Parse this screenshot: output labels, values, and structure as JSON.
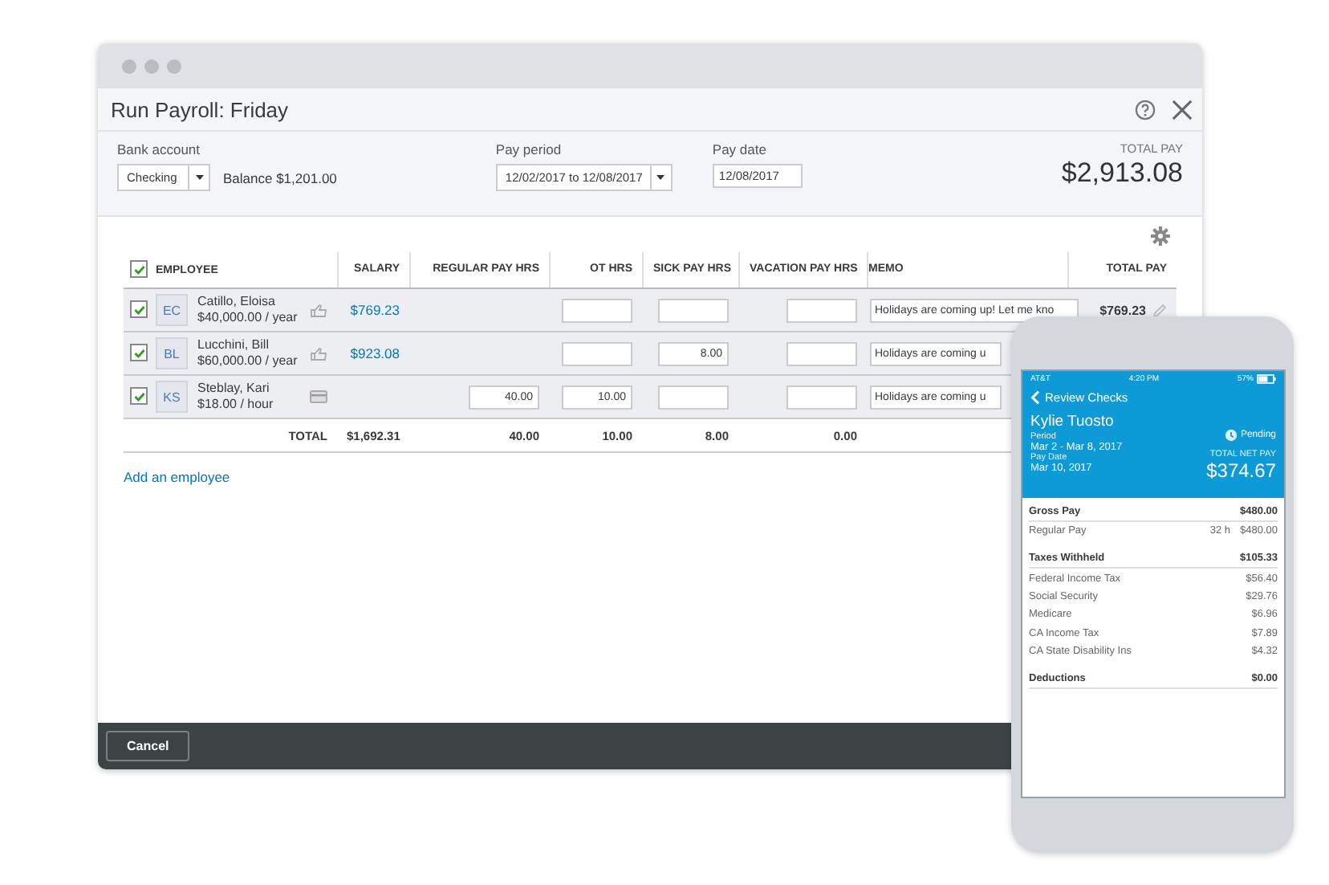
{
  "window": {
    "title": "Run Payroll: Friday"
  },
  "bank_account": {
    "label": "Bank account",
    "value": "Checking",
    "balance": "Balance $1,201.00"
  },
  "pay_period": {
    "label": "Pay period",
    "value": "12/02/2017 to 12/08/2017"
  },
  "pay_date": {
    "label": "Pay date",
    "value": "12/08/2017"
  },
  "total_pay": {
    "label": "TOTAL PAY",
    "amount": "$2,913.08"
  },
  "table": {
    "all_checked": true,
    "columns": [
      "EMPLOYEE",
      "SALARY",
      "REGULAR PAY HRS",
      "OT HRS",
      "SICK PAY HRS",
      "VACATION PAY HRS",
      "MEMO",
      "TOTAL PAY"
    ],
    "rows": [
      {
        "kind": "salaried",
        "checked": true,
        "initials": "EC",
        "name": "Catillo, Eloisa",
        "rate": "$40,000.00 / year",
        "salary": "$769.23",
        "memo": "Holidays are coming up! Let me kno",
        "total_pay": "$769.23"
      },
      {
        "kind": "salaried",
        "checked": true,
        "initials": "BL",
        "name": "Lucchini, Bill",
        "rate": "$60,000.00 / year",
        "salary": "$923.08",
        "sick_hrs": "8.00",
        "memo": "Holidays are coming u"
      },
      {
        "kind": "hourly",
        "checked": true,
        "initials": "KS",
        "name": "Steblay, Kari",
        "rate": "$18.00 / hour",
        "regular_hrs": "40.00",
        "ot_hrs": "10.00",
        "memo": "Holidays are coming u"
      }
    ],
    "totals": {
      "label": "TOTAL",
      "salary": "$1,692.31",
      "regular_hrs": "40.00",
      "ot_hrs": "10.00",
      "sick_hrs": "8.00",
      "vacation_hrs": "0.00"
    }
  },
  "add_employee": "Add an employee",
  "footer": {
    "cancel": "Cancel"
  },
  "phone": {
    "carrier": "AT&T",
    "time": "4:20 PM",
    "battery": "57%",
    "back": "Review Checks",
    "employee": "Kylie Tuosto",
    "period_label": "Period",
    "period": "Mar 2 - Mar 8, 2017",
    "pay_date_label": "Pay Date",
    "pay_date": "Mar 10, 2017",
    "status": "Pending",
    "net_label": "TOTAL NET PAY",
    "net_amount": "$374.67",
    "sections": [
      {
        "title": "Gross Pay",
        "amount": "$480.00",
        "lines": [
          {
            "label": "Regular Pay",
            "hours": "32 h",
            "amount": "$480.00"
          }
        ]
      },
      {
        "title": "Taxes Withheld",
        "amount": "$105.33",
        "lines": [
          {
            "label": "Federal Income Tax",
            "amount": "$56.40"
          },
          {
            "label": "Social Security",
            "amount": "$29.76"
          },
          {
            "label": "Medicare",
            "amount": "$6.96"
          },
          {
            "label": "CA Income Tax",
            "amount": "$7.89"
          },
          {
            "label": "CA State Disability Ins",
            "amount": "$4.32"
          }
        ]
      },
      {
        "title": "Deductions",
        "amount": "$0.00"
      }
    ]
  }
}
